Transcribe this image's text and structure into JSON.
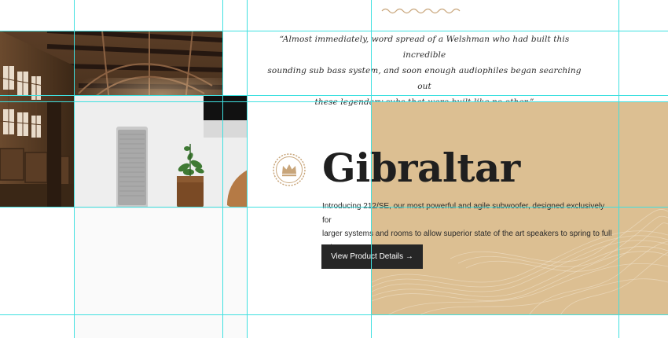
{
  "quote": {
    "line1": "“Almost immediately, word spread of a Welshman who had built this incredible",
    "line2": "sounding sub bass system, and soon enough audiophiles began searching out",
    "line3": "these legendary subs that were built like no other.”"
  },
  "product": {
    "title": "Gibraltar",
    "description_line1": "Introducing 212/SE, our most powerful and agile subwoofer, designed exclusively for",
    "description_line2": "larger systems and rooms to allow superior state of the art speakers to spring to full",
    "description_line3": "voice.",
    "cta_label": "View Product Details →"
  },
  "colors": {
    "accent_beige": "#dcbf92",
    "badge_tan": "#c8a57a",
    "button_dark": "#262626",
    "guide_cyan": "#3fe0e0"
  },
  "icons": {
    "badge": "crown-icon",
    "ornament": "wave-ornament"
  }
}
